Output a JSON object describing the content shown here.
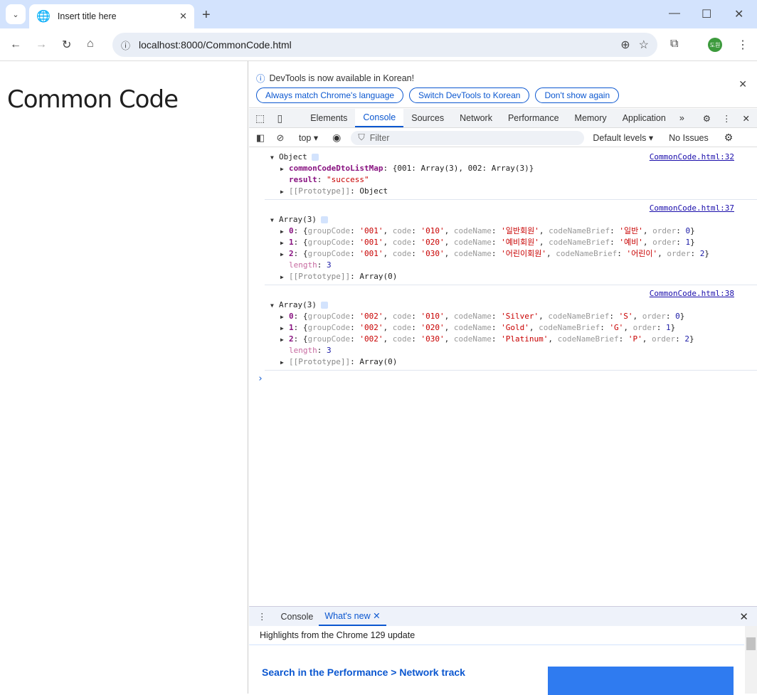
{
  "browser": {
    "tab_title": "Insert title here",
    "url": "localhost:8000/CommonCode.html",
    "profile_initials": "도원"
  },
  "page": {
    "heading": "Common Code"
  },
  "devtools": {
    "infobar": {
      "message": "DevTools is now available in Korean!",
      "buttons": [
        "Always match Chrome's language",
        "Switch DevTools to Korean",
        "Don't show again"
      ]
    },
    "tabs": [
      "Elements",
      "Console",
      "Sources",
      "Network",
      "Performance",
      "Memory",
      "Application"
    ],
    "active_tab": "Console",
    "toolbar": {
      "context": "top",
      "filter_placeholder": "Filter",
      "levels": "Default levels",
      "issues": "No Issues"
    },
    "logs": [
      {
        "source": "CommonCode.html:32",
        "header": "Object",
        "lines": [
          {
            "key": "commonCodeDtoListMap",
            "rest": "{001: Array(3), 002: Array(3)}"
          },
          {
            "key": "result",
            "str": "\"success\""
          },
          {
            "proto": "[[Prototype]]",
            "val": "Object"
          }
        ]
      },
      {
        "source": "CommonCode.html:37",
        "header": "Array(3)",
        "items": [
          {
            "i": "0",
            "groupCode": "'001'",
            "code": "'010'",
            "codeName": "'일반회원'",
            "codeNameBrief": "'일반'",
            "order": "0"
          },
          {
            "i": "1",
            "groupCode": "'001'",
            "code": "'020'",
            "codeName": "'예비회원'",
            "codeNameBrief": "'예비'",
            "order": "1"
          },
          {
            "i": "2",
            "groupCode": "'001'",
            "code": "'030'",
            "codeName": "'어린이회원'",
            "codeNameBrief": "'어린이'",
            "order": "2"
          }
        ],
        "length": "3",
        "proto": "Array(0)"
      },
      {
        "source": "CommonCode.html:38",
        "header": "Array(3)",
        "items": [
          {
            "i": "0",
            "groupCode": "'002'",
            "code": "'010'",
            "codeName": "'Silver'",
            "codeNameBrief": "'S'",
            "order": "0"
          },
          {
            "i": "1",
            "groupCode": "'002'",
            "code": "'020'",
            "codeName": "'Gold'",
            "codeNameBrief": "'G'",
            "order": "1"
          },
          {
            "i": "2",
            "groupCode": "'002'",
            "code": "'030'",
            "codeName": "'Platinum'",
            "codeNameBrief": "'P'",
            "order": "2"
          }
        ],
        "length": "3",
        "proto": "Array(0)"
      }
    ],
    "drawer": {
      "tabs": [
        "Console",
        "What's new"
      ],
      "subtitle": "Highlights from the Chrome 129 update",
      "article_title": "Search in the Performance > Network track"
    }
  }
}
